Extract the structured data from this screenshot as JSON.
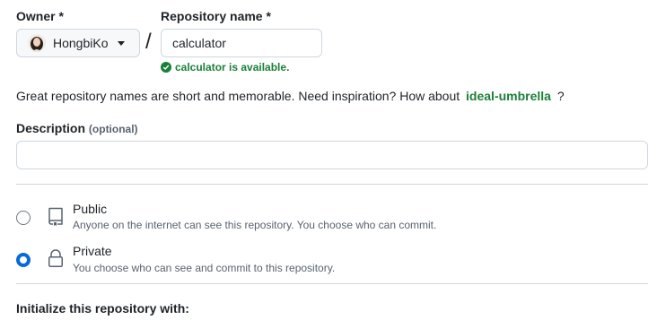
{
  "owner": {
    "label": "Owner *",
    "selected": "HongbiKo",
    "avatar_icon": "user-avatar"
  },
  "separator": "/",
  "repository": {
    "label": "Repository name *",
    "value": "calculator",
    "availability": "calculator is available.",
    "status_color": "#1a7f37"
  },
  "hint": {
    "text": "Great repository names are short and memorable. Need inspiration? How about",
    "suggestion": "ideal-umbrella",
    "suffix": "?"
  },
  "description": {
    "label": "Description",
    "optional": "(optional)",
    "value": ""
  },
  "visibility": {
    "options": [
      {
        "title": "Public",
        "description": "Anyone on the internet can see this repository. You choose who can commit.",
        "selected": false,
        "icon": "repo-icon"
      },
      {
        "title": "Private",
        "description": "You choose who can see and commit to this repository.",
        "selected": true,
        "icon": "lock-icon"
      }
    ]
  },
  "initialize": {
    "label": "Initialize this repository with:"
  },
  "colors": {
    "accent": "#0969da",
    "success": "#1a7f37",
    "border": "#d0d7de"
  }
}
